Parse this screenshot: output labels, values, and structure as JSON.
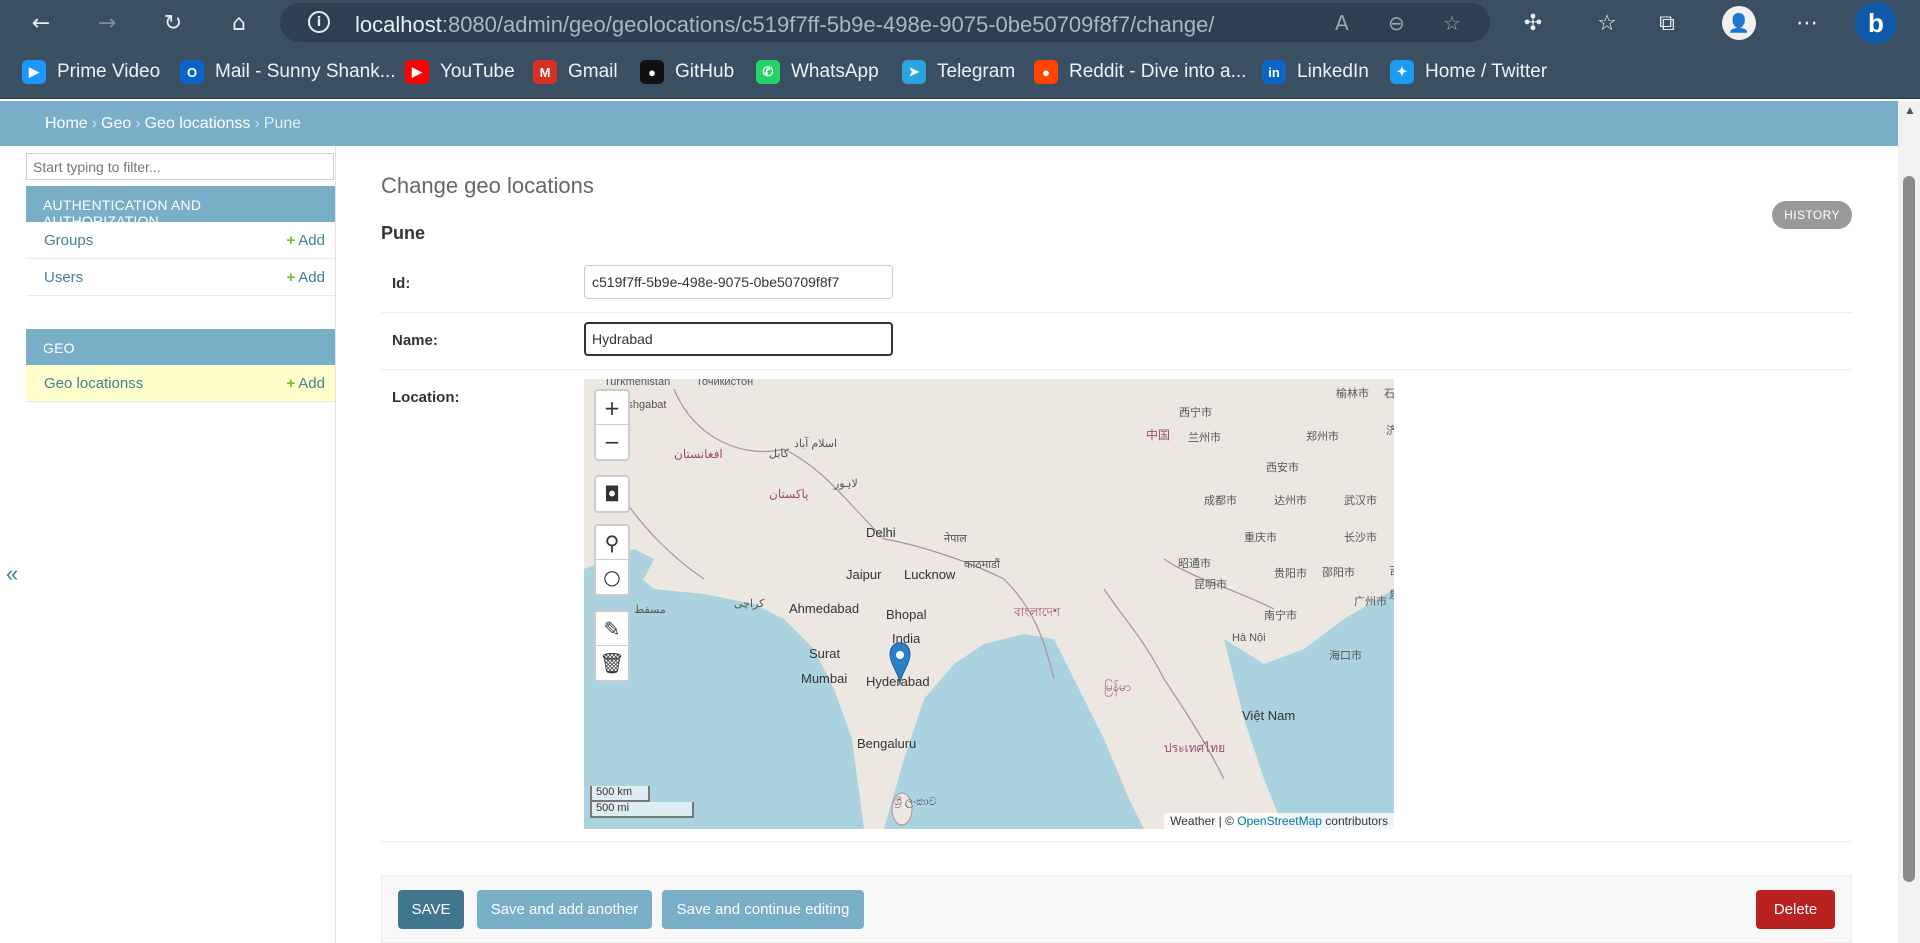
{
  "browser": {
    "url_host": "localhost",
    "url_rest": ":8080/admin/geo/geolocations/c519f7ff-5b9e-498e-9075-0be50709f8f7/change/",
    "bookmarks": [
      {
        "label": "Prime Video",
        "color": "#1a98ff",
        "glyph": "▶"
      },
      {
        "label": "Mail - Sunny Shank...",
        "color": "#0a64c8",
        "glyph": "O"
      },
      {
        "label": "YouTube",
        "color": "#ff0000",
        "glyph": "▶"
      },
      {
        "label": "Gmail",
        "color": "#d93025",
        "glyph": "M"
      },
      {
        "label": "GitHub",
        "color": "#111111",
        "glyph": "●"
      },
      {
        "label": "WhatsApp",
        "color": "#25d366",
        "glyph": "✆"
      },
      {
        "label": "Telegram",
        "color": "#2aa3de",
        "glyph": "➤"
      },
      {
        "label": "Reddit - Dive into a...",
        "color": "#ff4500",
        "glyph": "●"
      },
      {
        "label": "LinkedIn",
        "color": "#0a66c2",
        "glyph": "in"
      },
      {
        "label": "Home / Twitter",
        "color": "#1d9bf0",
        "glyph": "✦"
      }
    ]
  },
  "breadcrumb": {
    "home": "Home",
    "app": "Geo",
    "model": "Geo locationss",
    "current": "Pune"
  },
  "sidebar": {
    "filter_placeholder": "Start typing to filter...",
    "auth_caption": "AUTHENTICATION AND AUTHORIZATION",
    "auth_items": [
      {
        "label": "Groups",
        "add": "Add"
      },
      {
        "label": "Users",
        "add": "Add"
      }
    ],
    "geo_caption": "GEO",
    "geo_items": [
      {
        "label": "Geo locationss",
        "add": "Add"
      }
    ],
    "collapse": "«"
  },
  "content": {
    "title": "Change geo locations",
    "object_name": "Pune",
    "history": "HISTORY",
    "fields": {
      "id_label": "Id:",
      "id_value": "c519f7ff-5b9e-498e-9075-0be50709f8f7",
      "name_label": "Name:",
      "name_value": "Hydrabad",
      "location_label": "Location:"
    }
  },
  "map": {
    "labels": [
      "Turkmenistan",
      "Точикистон",
      "Ashgabat",
      "افغانستان",
      "کابل",
      "اسلام آباد",
      "لاہور",
      "پاکستان",
      "Delhi",
      "Jaipur",
      "Lucknow",
      "नेपाल",
      "काठमाडौं",
      "Ahmedabad",
      "Bhopal",
      "India",
      "کراچی",
      "مسقط",
      "Surat",
      "Mumbai",
      "Hyderabad",
      "Bengaluru",
      "বাংলাদেশ",
      "မြန်မာ",
      "ประเทศไทย",
      "Hà Nội",
      "Việt Nam",
      "中国",
      "西宁市",
      "兰州市",
      "西安市",
      "成都市",
      "重庆市",
      "昆明市",
      "南宁市",
      "广州市",
      "武汉市",
      "长沙市",
      "贵阳市",
      "榆林市",
      "石家庄",
      "济南",
      "郑州市",
      "达州市",
      "邵阳市",
      "吉安",
      "泉州",
      "海口市",
      "昭通市",
      "ශ්‍රී ලංකාව"
    ],
    "scale_km": "500 km",
    "scale_mi": "500 mi",
    "attribution_prefix": "Weather | ©",
    "attribution_link": "OpenStreetMap",
    "attribution_suffix": "contributors",
    "controls": {
      "zoom_in": "+",
      "zoom_out": "−"
    }
  },
  "actions": {
    "save": "SAVE",
    "save_add": "Save and add another",
    "save_continue": "Save and continue editing",
    "delete": "Delete"
  }
}
